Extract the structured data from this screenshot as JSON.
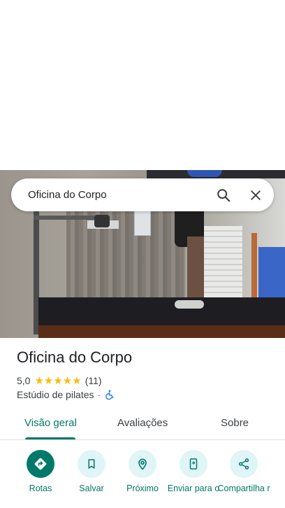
{
  "search": {
    "query": "Oficina do Corpo"
  },
  "place": {
    "name": "Oficina do Corpo",
    "rating": "5,0",
    "stars": "★★★★★",
    "review_count": "(11)",
    "category": "Estúdio de pilates",
    "separator": "·"
  },
  "tabs": [
    {
      "label": "Visão geral",
      "active": true
    },
    {
      "label": "Avaliações",
      "active": false
    },
    {
      "label": "Sobre",
      "active": false
    }
  ],
  "actions": [
    {
      "label": "Rotas",
      "icon": "directions-icon"
    },
    {
      "label": "Salvar",
      "icon": "bookmark-icon"
    },
    {
      "label": "Próximo",
      "icon": "nearby-icon"
    },
    {
      "label": "Enviar para o",
      "icon": "send-to-phone-icon"
    },
    {
      "label": "Compartilha r",
      "icon": "share-icon"
    }
  ],
  "colors": {
    "accent": "#00796b",
    "star": "#fbbc04",
    "action_bg": "#dff5f8",
    "wheelchair": "#1a73e8"
  }
}
